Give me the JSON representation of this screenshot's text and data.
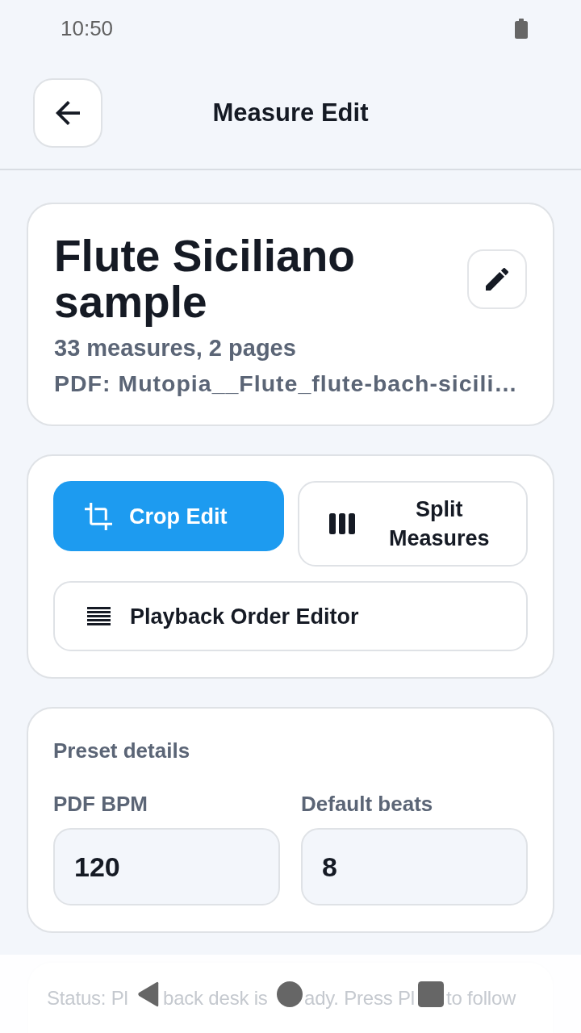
{
  "status_bar": {
    "time": "10:50"
  },
  "header": {
    "title": "Measure Edit"
  },
  "score": {
    "title": "Flute Siciliano sample",
    "summary": "33 measures, 2 pages",
    "pdf": "PDF: Mutopia__Flute_flute-bach-sicili…"
  },
  "actions": [
    {
      "label": "Crop Edit",
      "kind": "crop",
      "primary": true
    },
    {
      "label": "Split Measures",
      "kind": "split",
      "primary": false
    },
    {
      "label": "Playback Order Editor",
      "kind": "order",
      "primary": false
    }
  ],
  "preset": {
    "heading": "Preset details",
    "fields": [
      {
        "label": "PDF BPM",
        "value": "120"
      },
      {
        "label": "Default beats",
        "value": "8"
      }
    ]
  },
  "status": {
    "visible_parts": [
      "Status: Pl",
      "back desk is",
      "ady. Press Pl",
      "to follow"
    ]
  }
}
